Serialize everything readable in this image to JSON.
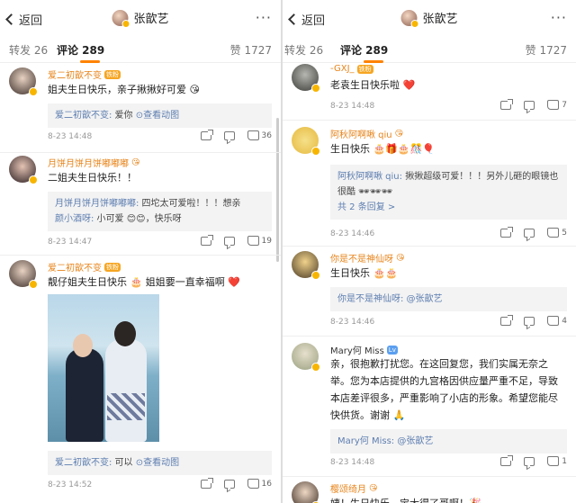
{
  "colors": {
    "accent": "#ff8200",
    "name": "#e7841a",
    "link": "#5d7eb0",
    "vip": "#f7b500"
  },
  "left": {
    "back_label": "返回",
    "title": "张歆艺",
    "more": "···",
    "tab_repost": "转发 26",
    "tab_comment": "评论 289",
    "tab_like": "赞 1727",
    "comments": [
      {
        "name": "爱二初歆不变",
        "text": "姐夫生日快乐，亲子揪揪好可爱",
        "emoji": "😘",
        "reply_user": "爱二初歆不变:",
        "reply_text": " 爱你 ",
        "reply_link": "查看动图",
        "time": "8-23 14:48",
        "likes": "36"
      },
      {
        "name": "月饼月饼月饼嘟嘟嘟",
        "text": "二姐夫生日快乐！！",
        "reply_user": "月饼月饼月饼嘟嘟嘟:",
        "reply_text": " 四坨太可爱啦！！！想亲",
        "reply_user2": "颜小酒呀:",
        "reply_text2": " 小可爱 😊😊，快乐呀",
        "time": "8-23 14:47",
        "likes": "19"
      },
      {
        "name": "爱二初歆不变",
        "text": "靓仔姐夫生日快乐 🎂 姐姐要一直幸福啊 ❤️",
        "reply_user": "爱二初歆不变:",
        "reply_text": " 可以 ",
        "reply_link": "查看动图",
        "time": "8-23 14:52",
        "likes": "16"
      }
    ]
  },
  "right": {
    "back_label": "返回",
    "title": "张歆艺",
    "more": "···",
    "tab_repost": "转发 26",
    "tab_comment": "评论 289",
    "tab_like": "赞 1727",
    "comments": [
      {
        "name": "-GXJ_",
        "text": "老袁生日快乐啦 ❤️",
        "time": "8-23 14:48",
        "likes": "7"
      },
      {
        "name": "阿秋阿啊啾 qiu",
        "text": "生日快乐 🎂🎁🎂🎊🎈",
        "reply_user": "阿秋阿啊啾 qiu:",
        "reply_text": " 揪揪超级可爱！！！另外儿砸的眼镜也很酷 🕶🕶🕶",
        "reply_more": "共 2 条回复 >",
        "time": "8-23 14:46",
        "likes": "5"
      },
      {
        "name": "你是不是神仙呀",
        "text": "生日快乐 🎂🎂",
        "reply_user": "你是不是神仙呀:",
        "reply_text": " @张歆艺",
        "time": "8-23 14:46",
        "likes": "4"
      },
      {
        "name": "Mary何 Miss",
        "text": "亲，很抱歉打扰您。在这回复您，我们实属无奈之举。您为本店提供的九宫格因供应量严重不足，导致本店差评很多，严重影响了小店的形象。希望您能尽快供货。谢谢 🙏",
        "reply_user": "Mary何 Miss:",
        "reply_text": " @张歆艺",
        "time": "8-23 14:48",
        "likes": "1"
      },
      {
        "name": "樱颂绮月",
        "text": "姨！生日快乐，宝大得了哥啊！🎉"
      }
    ]
  }
}
